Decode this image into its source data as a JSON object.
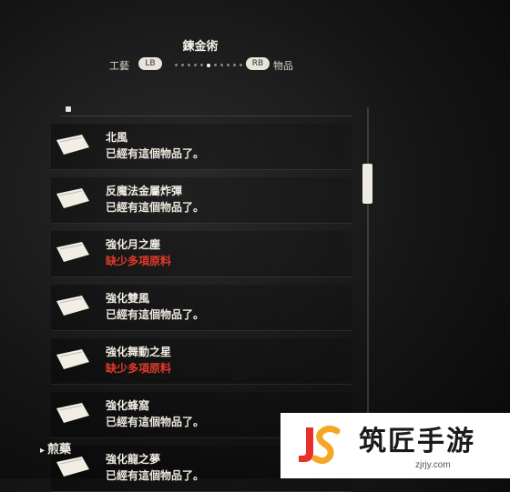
{
  "header": {
    "title": "鍊金術",
    "left_tab_label": "工藝",
    "left_tab_button": "LB",
    "right_tab_button": "RB",
    "right_tab_label": "物品"
  },
  "items": [
    {
      "name": "北風",
      "status": "已經有這個物品了。",
      "available": true
    },
    {
      "name": "反魔法金屬炸彈",
      "status": "已經有這個物品了。",
      "available": true
    },
    {
      "name": "強化月之塵",
      "status": "缺少多項原料",
      "available": false
    },
    {
      "name": "強化雙風",
      "status": "已經有這個物品了。",
      "available": true
    },
    {
      "name": "強化舞動之星",
      "status": "缺少多項原料",
      "available": false
    },
    {
      "name": "強化蜂窩",
      "status": "已經有這個物品了。",
      "available": true
    },
    {
      "name": "強化龍之夢",
      "status": "已經有這個物品了。",
      "available": true
    }
  ],
  "footer": {
    "category": "煎藥"
  },
  "watermark": {
    "name": "筑匠手游",
    "url": "zjrjy.com"
  },
  "colors": {
    "warning": "#e23a2a",
    "text": "#ece8dc",
    "accent": "#efebe0"
  }
}
